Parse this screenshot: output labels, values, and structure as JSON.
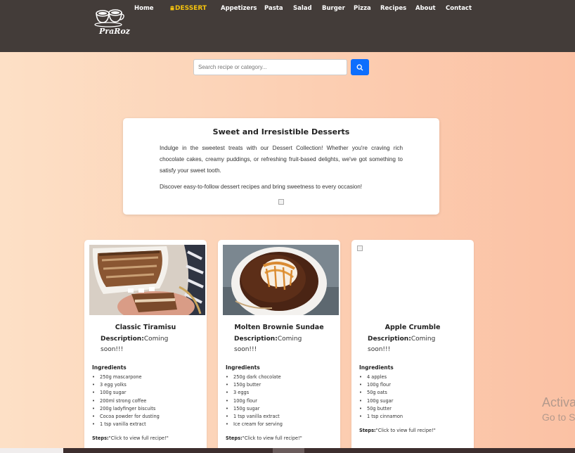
{
  "brand": {
    "name": "PraRoz",
    "logo_icon": "coffee-cups-logo-icon"
  },
  "nav": {
    "items": [
      {
        "label": "Home",
        "active": false
      },
      {
        "label": "DESSERT",
        "active": true
      },
      {
        "label": "Appetizers",
        "active": false
      },
      {
        "label": "Pasta",
        "active": false
      },
      {
        "label": "Salad",
        "active": false
      },
      {
        "label": "Burger",
        "active": false
      },
      {
        "label": "Pizza",
        "active": false
      },
      {
        "label": "Recipes",
        "active": false
      },
      {
        "label": "About",
        "active": false
      },
      {
        "label": "Contact",
        "active": false
      }
    ]
  },
  "search": {
    "placeholder": "Search recipe or category...",
    "value": "",
    "button_icon": "search-icon"
  },
  "intro": {
    "title": "Sweet and Irresistible Desserts",
    "paragraph1": "Indulge in the sweetest treats with our Dessert Collection! Whether you're craving rich chocolate cakes, creamy puddings, or refreshing fruit-based delights, we've got something to satisfy your sweet tooth.",
    "paragraph2": "Discover easy-to-follow dessert recipes and bring sweetness to every occasion!"
  },
  "cards": [
    {
      "title": "Classic Tiramisu",
      "desc_label": "Description:",
      "desc_text": "Coming soon!!!",
      "ingredients_heading": "Ingredients",
      "ingredients": [
        "250g mascarpone",
        "3 egg yolks",
        "100g sugar",
        "200ml strong coffee",
        "200g ladyfinger biscuits",
        "Cocoa powder for dusting",
        "1 tsp vanilla extract"
      ],
      "steps_label": "Steps:",
      "steps_text": "\"Click to view full recipe!\""
    },
    {
      "title": "Molten Brownie Sundae",
      "desc_label": "Description:",
      "desc_text": "Coming soon!!!",
      "ingredients_heading": "Ingredients",
      "ingredients": [
        "250g dark chocolate",
        "150g butter",
        "3 eggs",
        "100g flour",
        "150g sugar",
        "1 tsp vanilla extract",
        "Ice cream for serving"
      ],
      "steps_label": "Steps:",
      "steps_text": "\"Click to view full recipe!\""
    },
    {
      "title": "Apple Crumble",
      "desc_label": "Description:",
      "desc_text": "Coming soon!!!",
      "ingredients_heading": "Ingredients",
      "ingredients": [
        "4 apples",
        "100g flour",
        "50g oats",
        "100g sugar",
        "50g butter",
        "1 tsp cinnamon"
      ],
      "steps_label": "Steps:",
      "steps_text": "\"Click to view full recipe!\""
    }
  ],
  "watermark": {
    "line1": "Activa",
    "line2": "Go to S"
  },
  "colors": {
    "header_bg": "#433c39",
    "nav_active": "#f4c20d",
    "search_button": "#0d6efd"
  }
}
